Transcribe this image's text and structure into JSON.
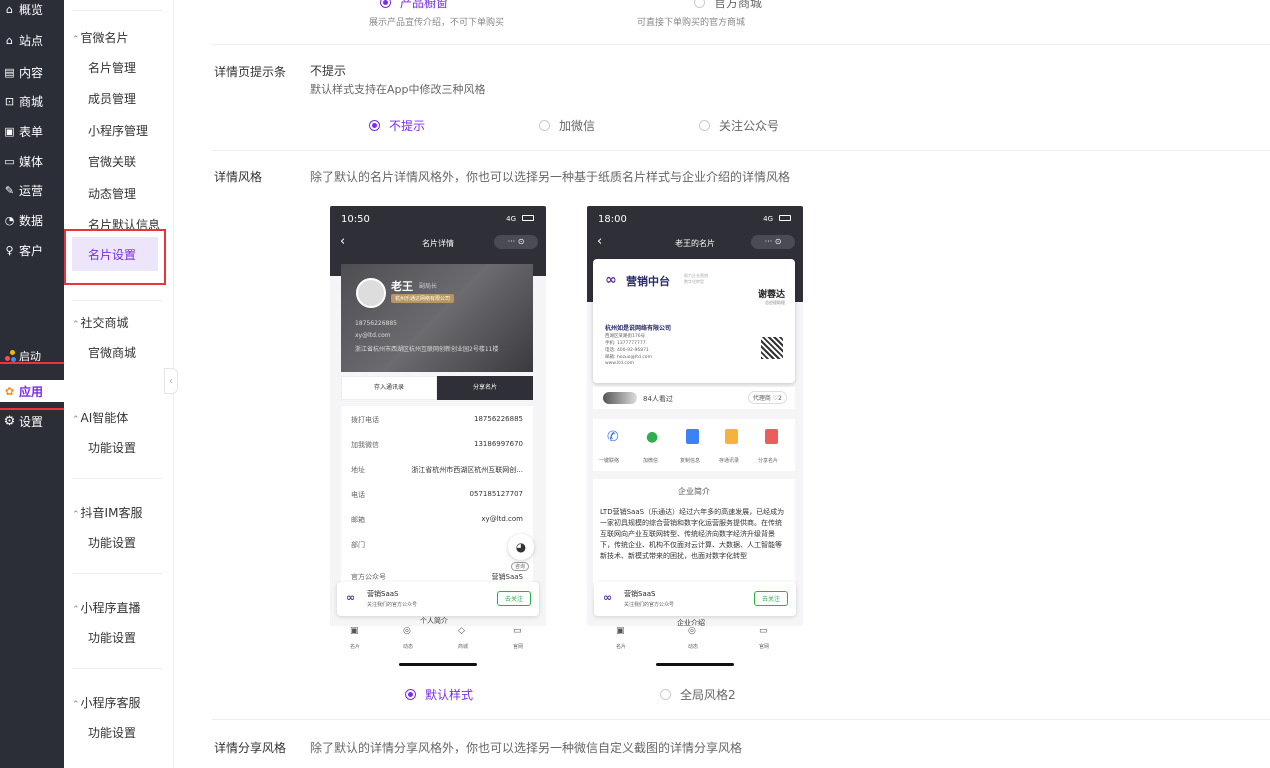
{
  "nav": {
    "items": [
      {
        "label": "概览",
        "icon": "home"
      },
      {
        "label": "站点",
        "icon": "site"
      },
      {
        "label": "内容",
        "icon": "document"
      },
      {
        "label": "商城",
        "icon": "cart"
      },
      {
        "label": "表单",
        "icon": "form"
      },
      {
        "label": "媒体",
        "icon": "media"
      },
      {
        "label": "运营",
        "icon": "pen"
      },
      {
        "label": "数据",
        "icon": "chart"
      },
      {
        "label": "客户",
        "icon": "user"
      }
    ],
    "launch": "启动",
    "apply": "应用",
    "settings": "设置"
  },
  "sub": {
    "group1": "官微名片",
    "items1": [
      "名片管理",
      "成员管理",
      "小程序管理",
      "官微关联",
      "动态管理",
      "名片默认信息",
      "名片设置"
    ],
    "group2": "社交商城",
    "items2": [
      "官微商城"
    ],
    "group3": "AI智能体",
    "group4": "抖音IM客服",
    "group5": "小程序直播",
    "group6": "小程序客服",
    "func": "功能设置"
  },
  "main": {
    "top": {
      "opt1": "产品橱窗",
      "opt1_desc": "展示产品宣传介绍，不可下单购买",
      "opt2": "官方商城",
      "opt2_desc": "可直接下单购买的官方商城"
    },
    "tip": {
      "label": "详情页提示条",
      "value": "不提示",
      "desc": "默认样式支持在App中修改三种风格",
      "options": [
        "不提示",
        "加微信",
        "关注公众号"
      ]
    },
    "style": {
      "label": "详情风格",
      "desc": "除了默认的名片详情风格外，你也可以选择另一种基于纸质名片样式与企业介绍的详情风格",
      "options": [
        "默认样式",
        "全局风格2"
      ]
    },
    "share": {
      "label": "详情分享风格",
      "desc": "除了默认的详情分享风格外，你也可以选择另一种微信自定义截图的详情分享风格"
    }
  },
  "phone1": {
    "time": "10:50",
    "signal": "4G",
    "title": "名片详情",
    "name": "老王",
    "role": "副局长",
    "company": "杭州乐通达网络有限公司",
    "phone": "18756226885",
    "email": "xy@ltd.com",
    "address": "浙江省杭州市西湖区杭州互联网创新创业园2号楼11楼",
    "btn1": "存入通讯录",
    "btn2": "分享名片",
    "rows": [
      {
        "label": "拨打电话",
        "value": "18756226885"
      },
      {
        "label": "加我微信",
        "value": "13186997670"
      },
      {
        "label": "地址",
        "value": "浙江省杭州市西湖区杭州互联网创..."
      },
      {
        "label": "电话",
        "value": "057185127707"
      },
      {
        "label": "邮箱",
        "value": "xy@ltd.com"
      },
      {
        "label": "部门",
        "value": ""
      },
      {
        "label": "官方公众号",
        "value": "营销SaaS"
      }
    ],
    "chat": "咨询",
    "banner_title": "营销SaaS",
    "banner_sub": "关注我们的官方公众号",
    "banner_btn": "去关注",
    "behind": "个人简介",
    "tabs": [
      "名片",
      "动态",
      "商城",
      "官网"
    ]
  },
  "phone2": {
    "time": "18:00",
    "signal": "4G",
    "title": "老王的名片",
    "brand": "营销中台",
    "brand_sub": "助力企业营销\n数字化转型",
    "name": "谢蓉达",
    "role": "总经理助理",
    "company": "杭州如是说网络有限公司",
    "lines": [
      "西湖区某路街176号",
      "手机: 1377777777",
      "电话: 400-92-96871",
      "邮箱: hezuo@ltd.com",
      "www.ltd.com"
    ],
    "viewers": "84人看过",
    "agent": "代理商",
    "likes": "2",
    "icons": [
      "一键联络",
      "加微信",
      "复制信息",
      "存通讯录",
      "分享名片"
    ],
    "intro_title": "企业简介",
    "intro": "LTD营销SaaS（乐通达）经过六年多的高速发展，已经成为一家初具规模的综合营销和数字化运营服务提供商。在传统互联网向产业互联网转型、传统经济向数字经济升级背景下，传统企业、机构不仅面对云计算、大数据、人工智能等新技术、新模式带来的困扰，也面对数字化转型",
    "banner_title": "营销SaaS",
    "banner_sub": "关注我们的官方公众号",
    "banner_btn": "去关注",
    "behind": "企业介绍",
    "tabs": [
      "名片",
      "动态",
      "官网"
    ]
  },
  "colors": {
    "accent": "#7b2cf0",
    "highlight": "#e8343b",
    "nav_bg": "#2b2e36"
  }
}
